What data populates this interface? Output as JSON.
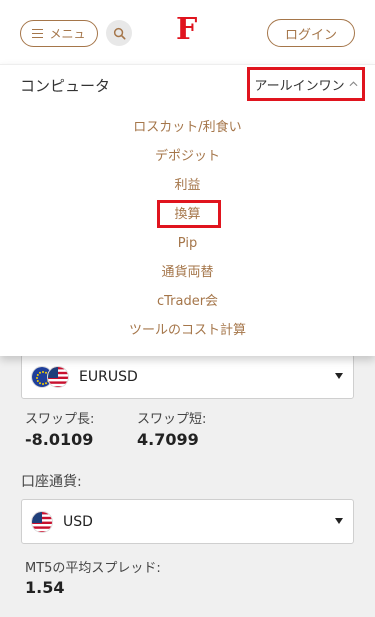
{
  "header": {
    "menu_label": "メニュ",
    "logo_text": "F",
    "login_label": "ログイン"
  },
  "dropdown": {
    "title": "コンピュータ",
    "toggle_label": "アールインワン",
    "items": [
      "ロスカット/利食い",
      "デポジット",
      "利益",
      "換算",
      "Pip",
      "通貨両替",
      "cTrader会",
      "ツールのコスト計算"
    ],
    "highlighted_item": "換算"
  },
  "pair_select": {
    "value": "EURUSD",
    "icons": [
      "eu-flag-icon",
      "us-flag-icon"
    ]
  },
  "swap": {
    "long_label": "スワップ長:",
    "long_value": "-8.0109",
    "short_label": "スワップ短:",
    "short_value": "4.7099"
  },
  "account_currency": {
    "label": "口座通貨:",
    "value": "USD",
    "icon": "us-flag-icon"
  },
  "spread": {
    "label": "MT5の平均スプレッド:",
    "value": "1.54"
  },
  "colors": {
    "accent": "#a5764a",
    "brand_red": "#e0141e",
    "background": "#f0f0f0"
  }
}
